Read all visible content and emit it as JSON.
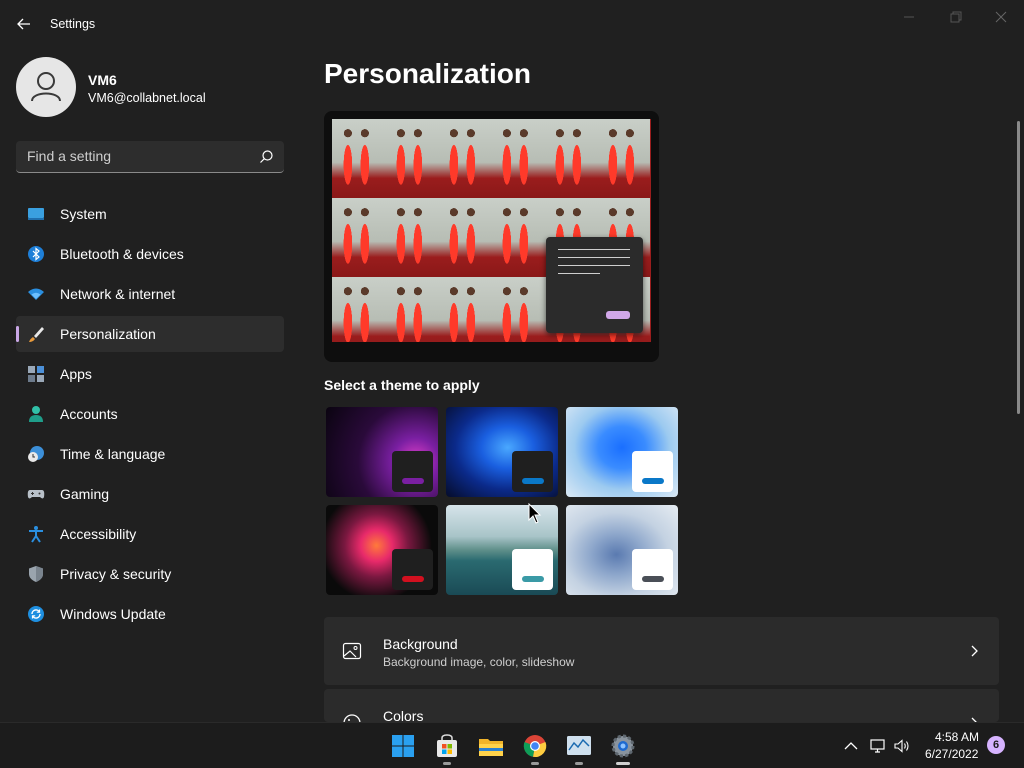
{
  "app": {
    "title": "Settings"
  },
  "profile": {
    "name": "VM6",
    "email": "VM6@collabnet.local"
  },
  "search": {
    "placeholder": "Find a setting"
  },
  "sidebar": {
    "items": [
      {
        "label": "System",
        "icon": "monitor-icon",
        "selected": false
      },
      {
        "label": "Bluetooth & devices",
        "icon": "bluetooth-icon",
        "selected": false
      },
      {
        "label": "Network & internet",
        "icon": "wifi-icon",
        "selected": false
      },
      {
        "label": "Personalization",
        "icon": "paintbrush-icon",
        "selected": true
      },
      {
        "label": "Apps",
        "icon": "apps-icon",
        "selected": false
      },
      {
        "label": "Accounts",
        "icon": "person-icon",
        "selected": false
      },
      {
        "label": "Time & language",
        "icon": "clock-globe-icon",
        "selected": false
      },
      {
        "label": "Gaming",
        "icon": "gamepad-icon",
        "selected": false
      },
      {
        "label": "Accessibility",
        "icon": "accessibility-icon",
        "selected": false
      },
      {
        "label": "Privacy & security",
        "icon": "shield-icon",
        "selected": false
      },
      {
        "label": "Windows Update",
        "icon": "sync-icon",
        "selected": false
      }
    ]
  },
  "main": {
    "title": "Personalization",
    "themes_label": "Select a theme to apply",
    "themes": [
      {
        "name": "theme-glow-purple",
        "accent": "#7a1fa2"
      },
      {
        "name": "theme-bloom-dark",
        "accent": "#0a78c8"
      },
      {
        "name": "theme-bloom-light",
        "accent": "#0a78c8"
      },
      {
        "name": "theme-captured-motion",
        "accent": "#d2101f"
      },
      {
        "name": "theme-lake",
        "accent": "#3a9aa6"
      },
      {
        "name": "theme-flow",
        "accent": "#4a4f57"
      }
    ],
    "cards": [
      {
        "title": "Background",
        "subtitle": "Background image, color, slideshow",
        "icon": "image-icon"
      },
      {
        "title": "Colors",
        "subtitle": "",
        "icon": "palette-icon"
      }
    ]
  },
  "taskbar": {
    "apps": [
      "windows-start-icon",
      "store-icon",
      "file-explorer-icon",
      "chrome-icon",
      "task-manager-icon",
      "settings-app-icon"
    ],
    "time": "4:58 AM",
    "date": "6/27/2022",
    "notification_count": "6"
  },
  "colors": {
    "accent": "#c9a7e6",
    "background": "#202020",
    "card": "#2b2b2b"
  }
}
